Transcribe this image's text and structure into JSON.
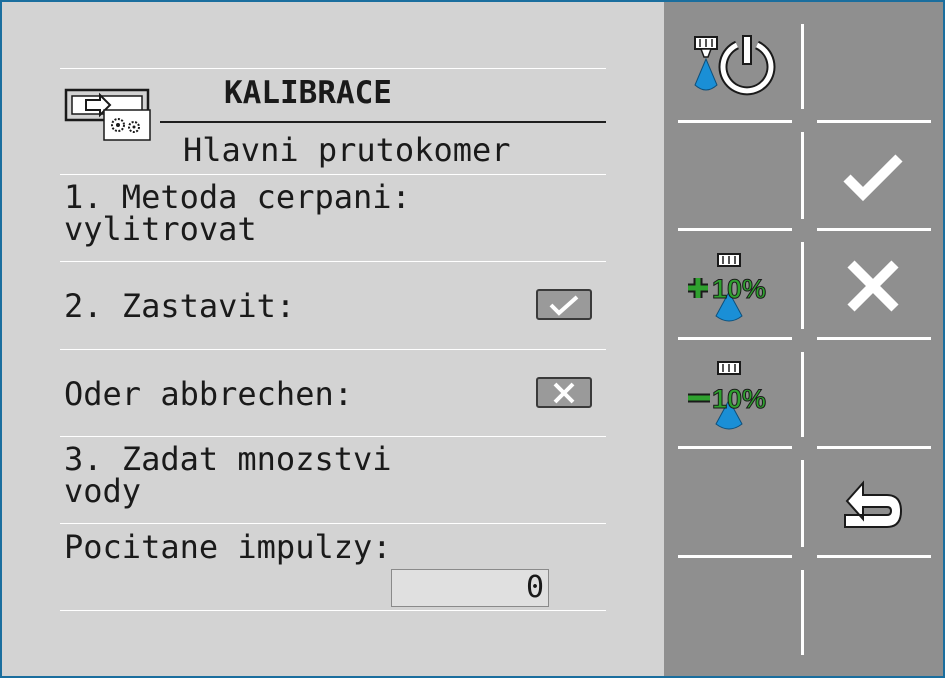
{
  "header": {
    "title": "KALIBRACE",
    "subtitle": "Hlavni prutokomer"
  },
  "rows": [
    {
      "line1": "1. Metoda cerpani:",
      "line2": "vylitrovat"
    },
    {
      "label": "2. Zastavit:",
      "action": "confirm"
    },
    {
      "label": "Oder abbrechen:",
      "action": "cancel"
    },
    {
      "line1": "3. Zadat mnozstvi",
      "line2": "vody"
    },
    {
      "label": "Pocitane impulzy:",
      "value": "0"
    }
  ],
  "softkeys": [
    {
      "name": "nozzle-power-icon",
      "label": ""
    },
    {
      "name": "plus-10-percent-icon",
      "label": "10%"
    },
    {
      "name": "minus-10-percent-icon",
      "label": "10%"
    },
    {
      "name": "checkmark-icon",
      "label": ""
    },
    {
      "name": "close-icon",
      "label": ""
    },
    {
      "name": "return-icon",
      "label": ""
    }
  ],
  "colors": {
    "frame": "#1a6e9e",
    "panel_left": "#d3d3d3",
    "panel_right": "#8f8f8f",
    "nozzle_blue": "#1a8fd6",
    "icon_green": "#2fa12f"
  }
}
